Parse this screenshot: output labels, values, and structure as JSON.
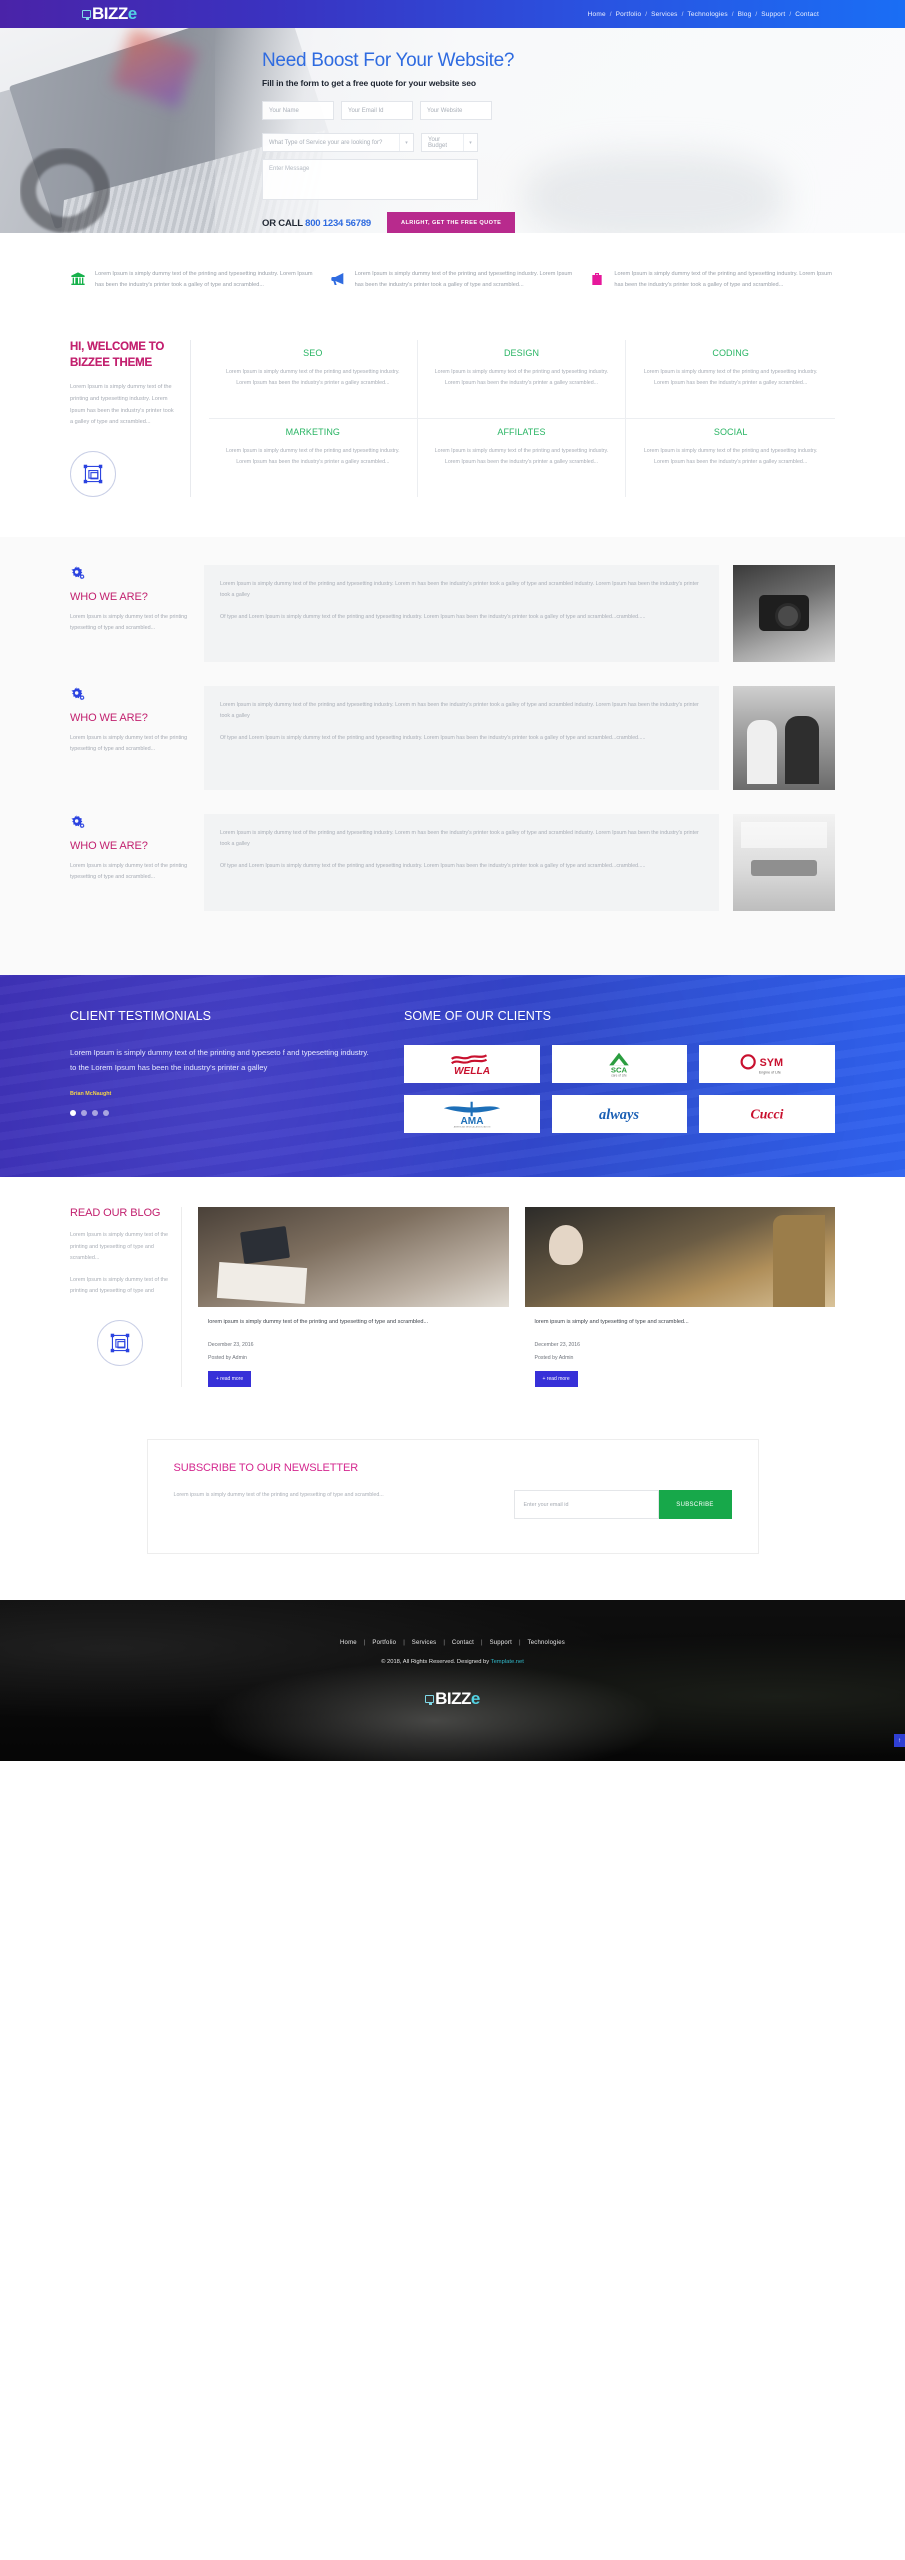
{
  "header": {
    "logo": {
      "name": "BIZZ",
      "accent": "e"
    },
    "nav": [
      {
        "label": "Home"
      },
      {
        "label": "Portfolio"
      },
      {
        "label": "Services"
      },
      {
        "label": "Technologies"
      },
      {
        "label": "Blog"
      },
      {
        "label": "Support"
      },
      {
        "label": "Contact"
      }
    ],
    "separator": "/"
  },
  "hero": {
    "title": "Need Boost For Your Website?",
    "subtitle": "Fill in the form to get a free quote for your website seo",
    "fields": {
      "name": "Your Name",
      "email": "Your Email Id",
      "website": "Your Website",
      "service": "What Type of Service your are looking for?",
      "budget": "Your Budget",
      "message": "Enter Message"
    },
    "or_call_label": "OR CALL",
    "phone": "800 1234 56789",
    "cta": "ALRIGHT, GET THE FREE QUOTE"
  },
  "features": [
    {
      "icon": "bank-icon",
      "color": "#16b14b",
      "text": "Lorem Ipsum is simply dummy text of the printing and typesetting industry. Lorem Ipsum has been the industry's printer took a galley of type and scrambled..."
    },
    {
      "icon": "megaphone-icon",
      "color": "#2f6be0",
      "text": "Lorem Ipsum is simply dummy text of the printing and typesetting industry. Lorem Ipsum has been the industry's printer took a galley of type and scrambled..."
    },
    {
      "icon": "briefcase-icon",
      "color": "#e6189b",
      "text": "Lorem Ipsum is simply dummy text of the printing and typesetting industry. Lorem Ipsum has been the industry's printer took a galley of type and scrambled..."
    }
  ],
  "welcome": {
    "title": "HI, WELCOME TO BIZZEE THEME",
    "copy": "Lorem Ipsum is simply dummy text of the printing and typesetting industry. Lorem Ipsum has been the industry's printer took a galley of type and scrambled...",
    "badge_icon": "crop-frame-icon"
  },
  "services": [
    {
      "title": "SEO",
      "copy": "Lorem Ipsum is simply dummy text of the printing and typesetting industry. Lorem Ipsum has been the industry's printer a galley scrambled..."
    },
    {
      "title": "DESIGN",
      "copy": "Lorem Ipsum is simply dummy text of the printing and typesetting industry. Lorem Ipsum has been the industry's printer a galley scrambled..."
    },
    {
      "title": "CODING",
      "copy": "Lorem Ipsum is simply dummy text of the printing and typesetting industry. Lorem Ipsum has been the industry's printer a galley scrambled..."
    },
    {
      "title": "MARKETING",
      "copy": "Lorem Ipsum is simply dummy text of the printing and typesetting industry. Lorem Ipsum has been the industry's printer a galley scrambled..."
    },
    {
      "title": "AFFILATES",
      "copy": "Lorem Ipsum is simply dummy text of the printing and typesetting industry. Lorem Ipsum has been the industry's printer a galley scrambled..."
    },
    {
      "title": "SOCIAL",
      "copy": "Lorem Ipsum is simply dummy text of the printing and typesetting industry. Lorem Ipsum has been the industry's printer a galley scrambled..."
    }
  ],
  "who_we_are": [
    {
      "icon": "gears-icon",
      "title": "WHO WE ARE?",
      "copy": "Lorem Ipsum is simply dummy text of the printing typesetting of type and scrambled...",
      "body1": "Lorem Ipsum is simply dummy text of the printing and typesetting industry. Lorem m has been the industry's printer took a galley of type and scrambled industry. Lorem Ipsum has been the industry's printer took a galley",
      "body2": "Of type and Lorem Ipsum is simply dummy text of the printing and typesetting industry. Lorem Ipsum has been the industry's printer took a galley of type and scrambled...crambled.....",
      "image": "photographer-photo"
    },
    {
      "icon": "gears-icon",
      "title": "WHO WE ARE?",
      "copy": "Lorem Ipsum is simply dummy text of the printing typesetting of type and scrambled...",
      "body1": "Lorem Ipsum is simply dummy text of the printing and typesetting industry. Lorem m has been the industry's printer took a galley of type and scrambled industry. Lorem Ipsum has been the industry's printer took a galley",
      "body2": "Of type and Lorem Ipsum is simply dummy text of the printing and typesetting industry. Lorem Ipsum has been the industry's printer took a galley of type and scrambled...crambled.....",
      "image": "couple-outdoors-photo"
    },
    {
      "icon": "gears-icon",
      "title": "WHO WE ARE?",
      "copy": "Lorem Ipsum is simply dummy text of the printing typesetting of type and scrambled...",
      "body1": "Lorem Ipsum is simply dummy text of the printing and typesetting industry. Lorem m has been the industry's printer took a galley of type and scrambled industry. Lorem Ipsum has been the industry's printer took a galley",
      "body2": "Of type and Lorem Ipsum is simply dummy text of the printing and typesetting industry. Lorem Ipsum has been the industry's printer took a galley of type and scrambled...crambled.....",
      "image": "meeting-room-photo"
    }
  ],
  "testimonials": {
    "heading": "CLIENT TESTIMONIALS",
    "quote": "Lorem Ipsum is simply dummy text of the printing and typeseto f and typesetting industry. to the Lorem Ipsum has been the industry's printer a galley",
    "author": "Brian McNaught",
    "dots": 4,
    "active_dot": 0
  },
  "clients": {
    "heading": "SOME OF OUR CLIENTS",
    "logos": [
      {
        "name": "WELLA",
        "color": "#c8102e"
      },
      {
        "name": "SCA",
        "sub": "care of life",
        "color": "#2a9d3f"
      },
      {
        "name": "SYM",
        "sub": "Engine of Life",
        "color": "#c8102e"
      },
      {
        "name": "AMA",
        "sub": "AMERICAN MEDICAL ASSOCIATION",
        "color": "#1d6fb8"
      },
      {
        "name": "always",
        "color": "#1a5fb4"
      },
      {
        "name": "Cucci",
        "color": "#c8102e"
      }
    ]
  },
  "blog": {
    "title": "READ OUR BLOG",
    "copy1": "Lorem Ipsum is simply dummy text of the printing and typesetting of type and scrambled...",
    "copy2": "Lorem Ipsum is simply dummy text of the printing and typesetting of type and",
    "badge_icon": "crop-frame-icon",
    "posts": [
      {
        "image": "team-meeting-photo",
        "title": "lorem ipsum is simply dummy text of the printing and typesetting of type and scrambled...",
        "date": "December 23, 2016",
        "author": "Posted by Admin",
        "button": "+ read more"
      },
      {
        "image": "office-discussion-photo",
        "title": "lorem ipsum is simply and typesetting of type and scrambled...",
        "date": "December 23, 2016",
        "author": "Posted by Admin",
        "button": "+ read more"
      }
    ]
  },
  "newsletter": {
    "heading": "SUBSCRIBE TO OUR NEWSLETTER",
    "copy": "Lorem ipsum is simply dummy text of the printing and typesetting of type and scrambled...",
    "input_placeholder": "Enter your email id",
    "button": "SUBSCRIBE"
  },
  "footer": {
    "nav": [
      {
        "label": "Home"
      },
      {
        "label": "Portfolio"
      },
      {
        "label": "Services"
      },
      {
        "label": "Contact"
      },
      {
        "label": "Support"
      },
      {
        "label": "Technologies"
      }
    ],
    "separator": "|",
    "copyright_prefix": "© 2018, All Rights Reserved. Designed by ",
    "copyright_link": "Template.net",
    "logo": {
      "name": "BIZZ",
      "accent": "e"
    },
    "to_top": "↑"
  }
}
